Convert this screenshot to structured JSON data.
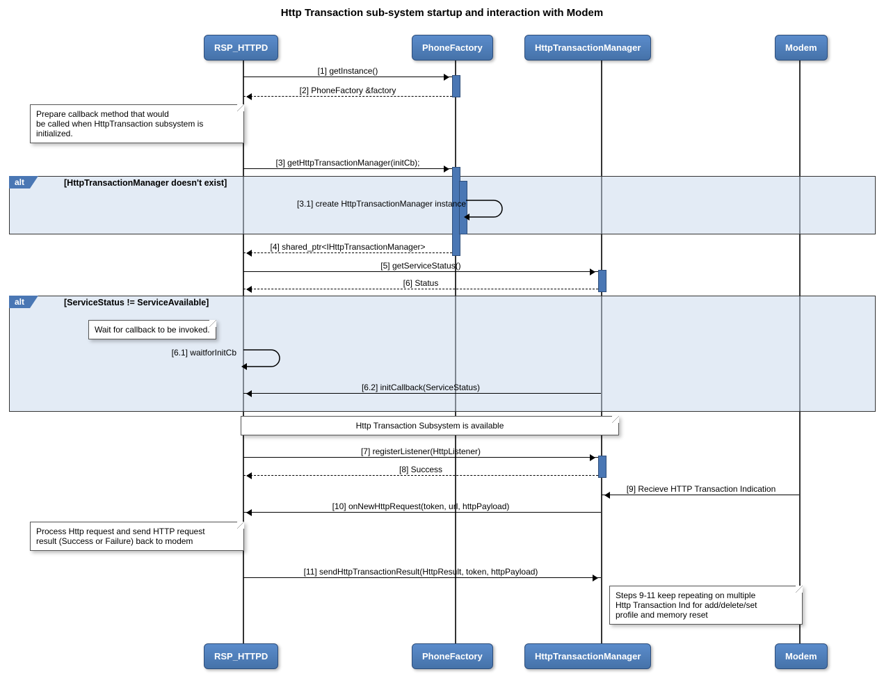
{
  "title": "Http Transaction sub-system startup and interaction with Modem",
  "participants": {
    "p1": "RSP_HTTPD",
    "p2": "PhoneFactory",
    "p3": "HttpTransactionManager",
    "p4": "Modem"
  },
  "messages": {
    "m1": "[1] getInstance()",
    "m2": "[2] PhoneFactory &factory",
    "m3": "[3] getHttpTransactionManager(initCb);",
    "m3_1": "[3.1] create HttpTransactionManager instance",
    "m4": "[4] shared_ptr<IHttpTransactionManager>",
    "m5": "[5] getServiceStatus()",
    "m6": "[6] Status",
    "m6_1": "[6.1] waitforInitCb",
    "m6_2": "[6.2] initCallback(ServiceStatus)",
    "m7": "[7] registerListener(HttpListener)",
    "m8": "[8] Success",
    "m9": "[9] Recieve HTTP Transaction Indication",
    "m10": "[10] onNewHttpRequest(token, url, httpPayload)",
    "m11": "[11] sendHttpTransactionResult(HttpResult, token, httpPayload)"
  },
  "fragments": {
    "alt1_label": "alt",
    "alt1_guard": "[HttpTransactionManager doesn't exist]",
    "alt2_label": "alt",
    "alt2_guard": "[ServiceStatus != ServiceAvailable]"
  },
  "notes": {
    "n1": "Prepare callback method that would\nbe called when HttpTransaction subsystem is\ninitialized.",
    "n2": "Wait for callback to be invoked.",
    "n3": "Http Transaction Subsystem is available",
    "n4": "Process Http request and send HTTP request\nresult (Success or Failure) back to modem",
    "n5": "Steps 9-11 keep repeating on multiple\nHttp Transaction Ind for add/delete/set\nprofile and memory reset"
  }
}
